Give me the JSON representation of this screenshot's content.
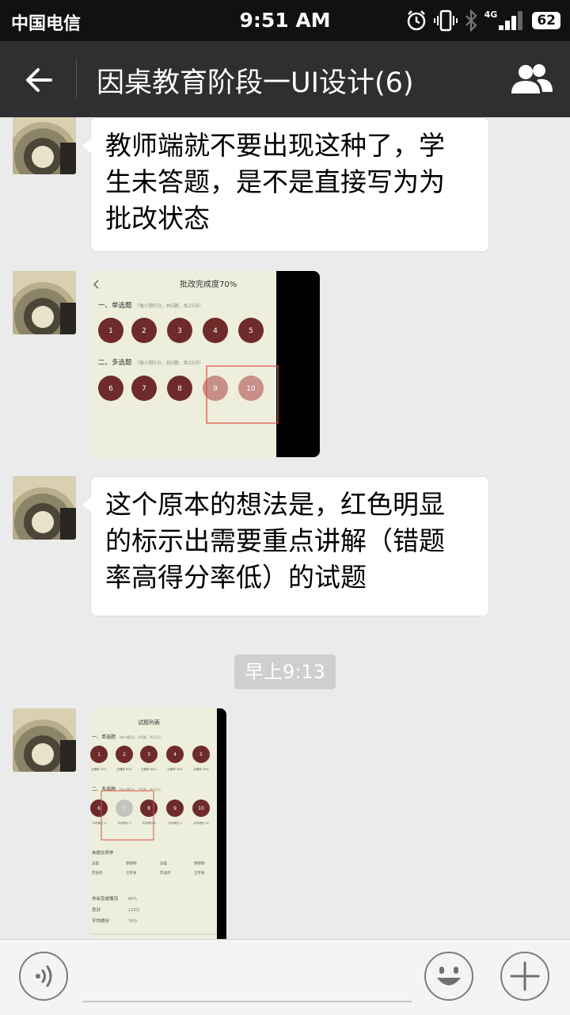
{
  "status_bar": {
    "carrier": "中国电信",
    "time": "9:51 AM",
    "network": "4G",
    "battery": "62"
  },
  "nav": {
    "title": "因桌教育阶段一UI设计(6)"
  },
  "messages": {
    "m1": {
      "lines": [
        "教师端就不要出现这种了，学",
        "生未答题，是不是直接写为为",
        "批改状态"
      ]
    },
    "m2": {
      "title": "批改完成度70%",
      "sec1": "一、单选题",
      "sec1_note": "（每小题5分，共5题，共25分）",
      "sec1_nums": [
        "1",
        "2",
        "3",
        "4",
        "5"
      ],
      "sec2": "二、多选题",
      "sec2_note": "（每小题5分，共5题，共25分）",
      "sec2_nums": [
        "6",
        "7",
        "8",
        "9",
        "10"
      ]
    },
    "m3": {
      "lines": [
        "这个原本的想法是，红色明显",
        "的标示出需要重点讲解（错题",
        "率高得分率低）的试题"
      ]
    },
    "timestamp": "早上9:13",
    "m4": {
      "title": "试题列表",
      "sec1": "一、单选题",
      "sec1_note": "（每小题5分，共5题，共25分）",
      "sec1_nums": [
        "1",
        "2",
        "3",
        "4",
        "5"
      ],
      "sec1_stats": [
        "正确率 70%",
        "正确率 60%",
        "正确率 80%",
        "正确率 20%",
        "正确率 30%"
      ],
      "sec2": "二、多选题",
      "sec2_note": "（每小题5分，共5题，共25分）",
      "sec2_nums": [
        "6",
        "7",
        "8",
        "9",
        "10"
      ],
      "sec2_stats": [
        "平均得分 4",
        "平均得分 1",
        "平均得分 4",
        "平均得分 3",
        "平均得分 12"
      ],
      "unsubmitted_label": "未提交同学",
      "students": [
        "吴磊",
        "郭晓明",
        "吴磊",
        "郭晓明",
        "苏浩然",
        "汪宇泉",
        "苏浩然",
        "汪宇泉"
      ],
      "stats": [
        {
          "label": "作业完成情况",
          "value": "80%"
        },
        {
          "label": "总分",
          "value": "120分"
        },
        {
          "label": "平均得分",
          "value": "78分"
        }
      ]
    }
  },
  "colors": {
    "status_bg": "#111111",
    "nav_bg": "#2f2f31",
    "chat_bg": "#ebebeb",
    "dot": "#6e2b2a",
    "dot_light": "#c88e88",
    "highlight": "#e05040",
    "card_bg": "#eeeedd"
  }
}
